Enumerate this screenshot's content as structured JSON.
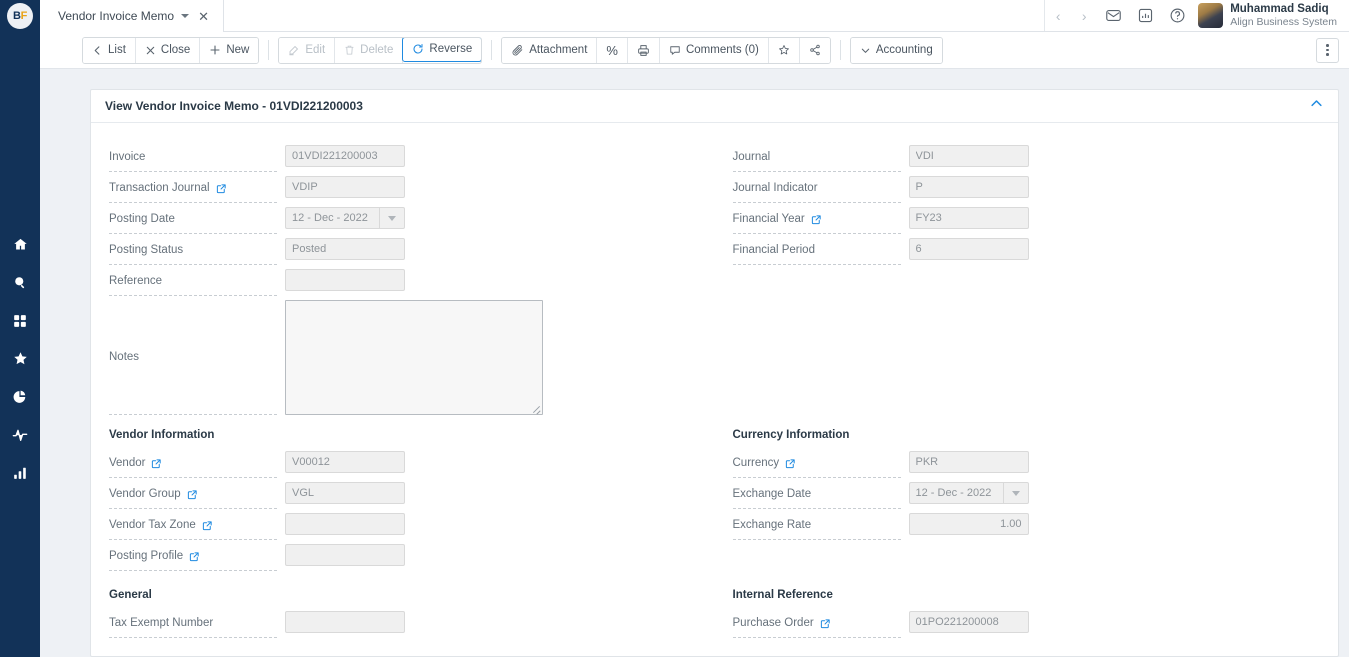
{
  "app": {
    "logo_b": "B",
    "logo_f": "F"
  },
  "sidebar": {
    "items": [
      {
        "name": "home-icon",
        "label": "Home"
      },
      {
        "name": "search-icon",
        "label": "Search"
      },
      {
        "name": "apps-grid-icon",
        "label": "Apps"
      },
      {
        "name": "star-icon",
        "label": "Favorites"
      },
      {
        "name": "pie-chart-icon",
        "label": "Reports"
      },
      {
        "name": "activity-pulse-icon",
        "label": "Activity"
      },
      {
        "name": "bar-chart-icon",
        "label": "Analytics"
      }
    ]
  },
  "tabbar": {
    "tab_label": "Vendor Invoice Memo",
    "close_label": "✕",
    "prev_label": "‹",
    "next_label": "›",
    "icons": [
      "mail-icon",
      "reports-icon",
      "help-icon"
    ],
    "user_name": "Muhammad Sadiq",
    "user_org": "Align Business System"
  },
  "toolbar": {
    "list_label": "List",
    "close_label": "Close",
    "new_label": "New",
    "edit_label": "Edit",
    "delete_label": "Delete",
    "reverse_label": "Reverse",
    "attachment_label": "Attachment",
    "percent_label": "%",
    "print_label": "print-icon",
    "comments_label": "Comments (0)",
    "favorite_label": "star-icon",
    "share_label": "share-icon",
    "accounting_label": "Accounting",
    "more_label": "kebab-menu"
  },
  "card": {
    "title": "View Vendor Invoice Memo - 01VDI221200003",
    "collapse_icon": "chevron-up-icon"
  },
  "form": {
    "left": [
      {
        "label": "Invoice",
        "value": "01VDI221200003",
        "link": false,
        "type": "text"
      },
      {
        "label": "Transaction Journal",
        "value": "VDIP",
        "link": true,
        "type": "text"
      },
      {
        "label": "Posting Date",
        "value": "12 - Dec - 2022",
        "link": false,
        "type": "date"
      },
      {
        "label": "Posting Status",
        "value": "Posted",
        "link": false,
        "type": "text"
      },
      {
        "label": "Reference",
        "value": "",
        "link": false,
        "type": "text"
      }
    ],
    "right": [
      {
        "label": "Journal",
        "value": "VDI",
        "link": false,
        "type": "text"
      },
      {
        "label": "Journal Indicator",
        "value": "P",
        "link": false,
        "type": "text"
      },
      {
        "label": "Financial Year",
        "value": "FY23",
        "link": true,
        "type": "text"
      },
      {
        "label": "Financial Period",
        "value": "6",
        "link": false,
        "type": "text"
      }
    ],
    "notes_label": "Notes",
    "notes_value": ""
  },
  "sections": {
    "vendor_information": {
      "title": "Vendor Information",
      "fields": [
        {
          "label": "Vendor",
          "value": "V00012",
          "link": true,
          "type": "text"
        },
        {
          "label": "Vendor Group",
          "value": "VGL",
          "link": true,
          "type": "text"
        },
        {
          "label": "Vendor Tax Zone",
          "value": "",
          "link": true,
          "type": "text"
        },
        {
          "label": "Posting Profile",
          "value": "",
          "link": true,
          "type": "text"
        }
      ]
    },
    "currency_information": {
      "title": "Currency Information",
      "fields": [
        {
          "label": "Currency",
          "value": "PKR",
          "link": true,
          "type": "text"
        },
        {
          "label": "Exchange Date",
          "value": "12 - Dec - 2022",
          "link": false,
          "type": "date"
        },
        {
          "label": "Exchange Rate",
          "value": "1.00",
          "link": false,
          "type": "number"
        }
      ]
    },
    "general": {
      "title": "General",
      "fields": [
        {
          "label": "Tax Exempt Number",
          "value": "",
          "link": false,
          "type": "text"
        }
      ]
    },
    "internal_reference": {
      "title": "Internal Reference",
      "fields": [
        {
          "label": "Purchase Order",
          "value": "01PO221200008",
          "link": true,
          "type": "text"
        }
      ]
    }
  },
  "colors": {
    "sidebar_bg": "#123258",
    "page_bg": "#eef1f5",
    "accent_blue": "#1f8ae0",
    "logo_gold": "#e8a317",
    "field_bg": "#f0f0f0"
  }
}
